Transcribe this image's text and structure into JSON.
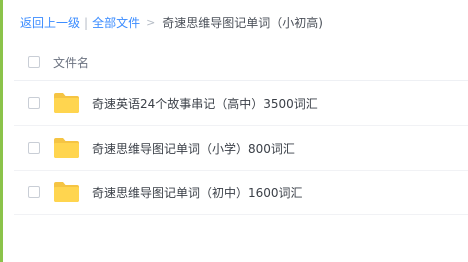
{
  "breadcrumb": {
    "back": "返回上一级",
    "sep": "|",
    "all_files": "全部文件",
    "gt": ">",
    "current": "奇速思维导图记单词（小初高)"
  },
  "list": {
    "header_label": "文件名",
    "items": [
      {
        "name": "奇速英语24个故事串记（高中）3500词汇",
        "icon": "folder-icon"
      },
      {
        "name": "奇速思维导图记单词（小学）800词汇",
        "icon": "folder-icon"
      },
      {
        "name": "奇速思维导图记单词（初中）1600词汇",
        "icon": "folder-icon"
      }
    ]
  },
  "colors": {
    "link": "#3b8cff",
    "folder": "#ffd54f",
    "left_accent": "#8bc34a"
  }
}
